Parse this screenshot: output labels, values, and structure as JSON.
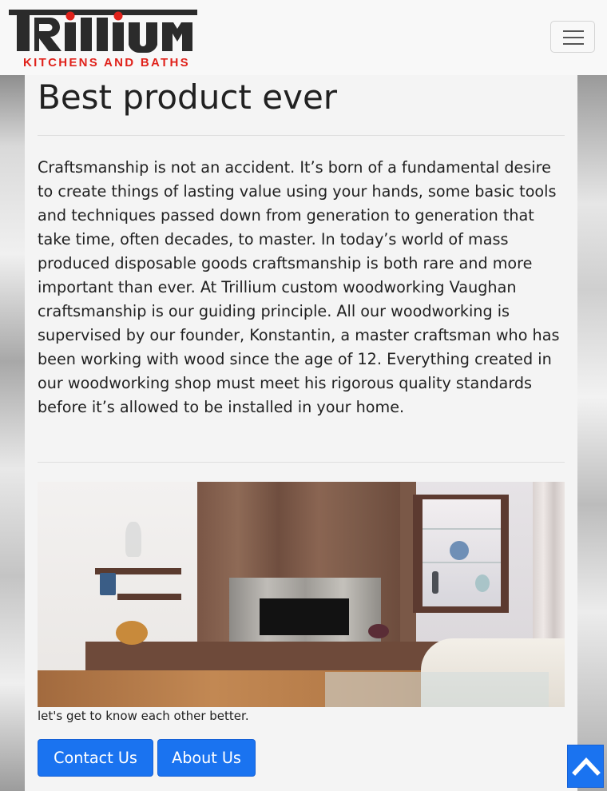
{
  "brand": {
    "name": "Trillium",
    "subtitle": "KITCHENS AND BATHS",
    "red": "#e0221b",
    "dark": "#2b2b2b"
  },
  "navbar": {
    "toggler_icon": "hamburger-icon"
  },
  "main": {
    "title": "Best product ever",
    "body": "Craftsmanship is not an accident. It’s born of a fundamental desire to create things of lasting value using your hands, some basic tools and techniques passed down from generation to generation that take time, often decades, to master. In today’s world of mass produced disposable goods craftsmanship is both rare and more important than ever. At Trillium custom woodworking Vaughan craftsmanship is our guiding principle. All our woodworking is supervised by our founder, Konstantin, a master craftsman who has been working with wood since the age of 12. Everything created in our woodworking shop must meet his rigorous quality standards before it’s allowed to be installed in your home.",
    "tagline": "let's get to know each other better.",
    "buttons": {
      "contact": "Contact Us",
      "about": "About Us"
    },
    "accent": "#1a73f0"
  },
  "scroll_top": {
    "icon": "chevron-up-icon"
  }
}
